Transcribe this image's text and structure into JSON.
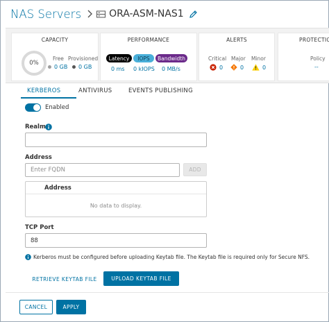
{
  "header": {
    "breadcrumb": "NAS Servers",
    "server_name": "ORA-ASM-NAS1"
  },
  "summary": {
    "capacity": {
      "title": "CAPACITY",
      "percent": "0%",
      "free_label": "Free",
      "provisioned_label": "Provisioned",
      "free_value": "0 GB",
      "provisioned_value": "0 GB"
    },
    "performance": {
      "title": "PERFORMANCE",
      "pills": [
        {
          "label": "Latency",
          "value": "0 ms",
          "color": "#000000"
        },
        {
          "label": "IOPS",
          "value": "0 kIOPS",
          "color": "#49afd9"
        },
        {
          "label": "Bandwidth",
          "value": "0 MB/s",
          "color": "#6b2a8a"
        }
      ]
    },
    "alerts": {
      "title": "ALERTS",
      "critical_label": "Critical",
      "major_label": "Major",
      "minor_label": "Minor",
      "critical_value": "0",
      "major_value": "0",
      "minor_value": "0"
    },
    "protection": {
      "title": "PROTECTIO",
      "policy_label": "Policy",
      "policy_value": "--"
    }
  },
  "tabs": [
    "KERBEROS",
    "ANTIVIRUS",
    "EVENTS PUBLISHING"
  ],
  "form": {
    "enabled_label": "Enabled",
    "realm_label": "Realm",
    "realm_value": "",
    "address_label": "Address",
    "address_placeholder": "Enter FQDN",
    "add_button": "ADD",
    "address_column": "Address",
    "empty_text": "No data to display.",
    "tcp_port_label": "TCP Port",
    "tcp_port_value": "88",
    "note": "Kerberos must be configured before uploading Keytab file. The Keytab file is required only for Secure NFS.",
    "retrieve_button": "RETRIEVE KEYTAB FILE",
    "upload_button": "UPLOAD KEYTAB FILE"
  },
  "footer": {
    "cancel_button": "CANCEL",
    "apply_button": "APPLY"
  },
  "colors": {
    "accent": "#0072a3",
    "critical": "#c92100",
    "major": "#f57600",
    "minor": "#fdd006"
  }
}
